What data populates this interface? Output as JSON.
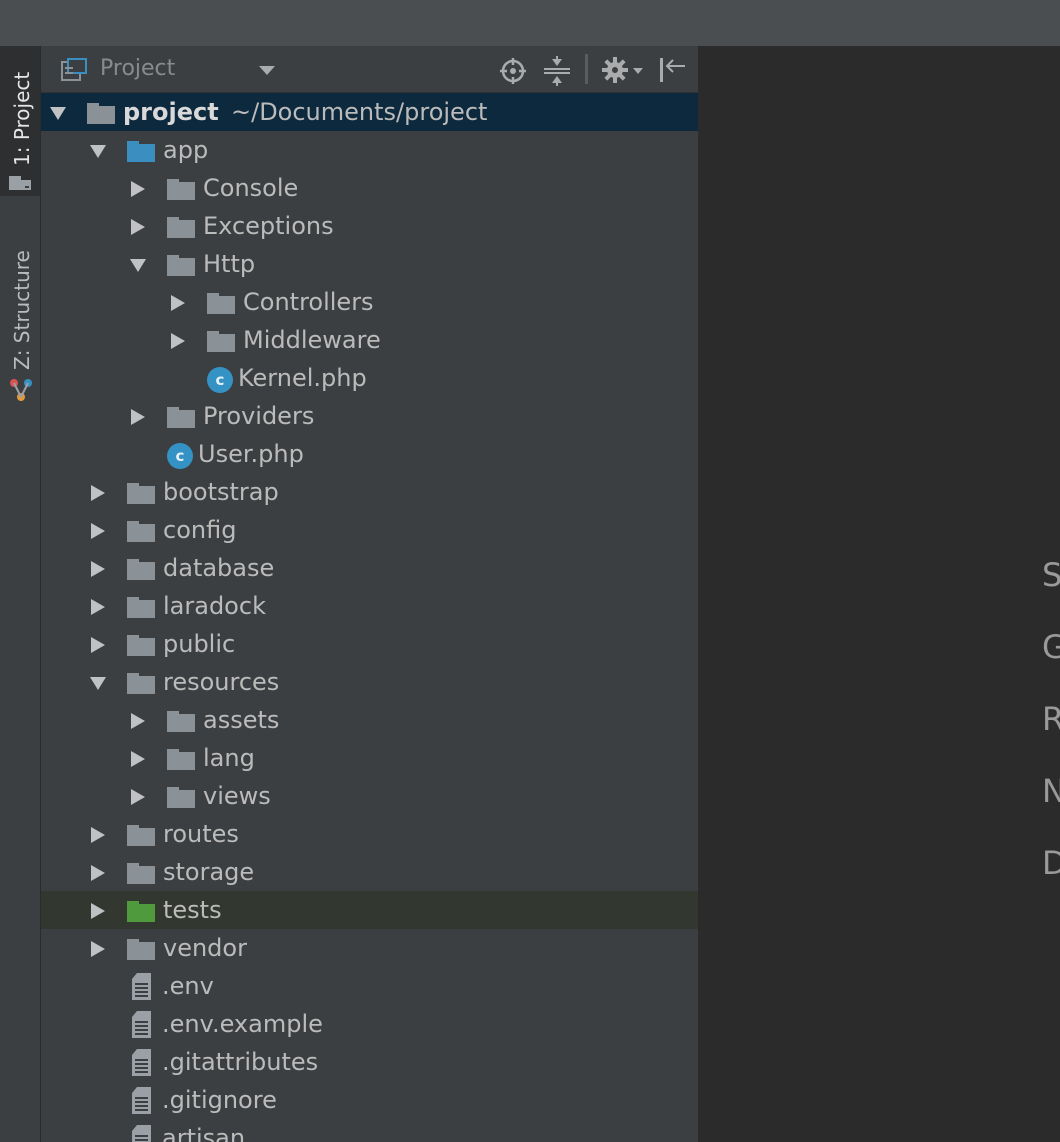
{
  "toolstrip": {
    "tabs": [
      {
        "label": "1: Project",
        "active": true,
        "icon": "folder-icon"
      },
      {
        "label": "Z: Structure",
        "active": false,
        "icon": "structure-icon"
      }
    ]
  },
  "panel": {
    "title": "Project",
    "toolbar_icons": [
      "scope-icon",
      "collapse-all-icon",
      "gear-icon",
      "hide-icon"
    ]
  },
  "tree": [
    {
      "label": "project",
      "path": "~/Documents/project",
      "depth": 0,
      "type": "folder",
      "expanded": true,
      "selected": true
    },
    {
      "label": "app",
      "depth": 1,
      "type": "folder-source",
      "expanded": true
    },
    {
      "label": "Console",
      "depth": 2,
      "type": "folder",
      "expanded": false
    },
    {
      "label": "Exceptions",
      "depth": 2,
      "type": "folder",
      "expanded": false
    },
    {
      "label": "Http",
      "depth": 2,
      "type": "folder",
      "expanded": true
    },
    {
      "label": "Controllers",
      "depth": 3,
      "type": "folder",
      "expanded": false
    },
    {
      "label": "Middleware",
      "depth": 3,
      "type": "folder",
      "expanded": false
    },
    {
      "label": "Kernel.php",
      "depth": 3,
      "type": "class"
    },
    {
      "label": "Providers",
      "depth": 2,
      "type": "folder",
      "expanded": false
    },
    {
      "label": "User.php",
      "depth": 2,
      "type": "class"
    },
    {
      "label": "bootstrap",
      "depth": 1,
      "type": "folder",
      "expanded": false
    },
    {
      "label": "config",
      "depth": 1,
      "type": "folder",
      "expanded": false
    },
    {
      "label": "database",
      "depth": 1,
      "type": "folder",
      "expanded": false
    },
    {
      "label": "laradock",
      "depth": 1,
      "type": "folder",
      "expanded": false
    },
    {
      "label": "public",
      "depth": 1,
      "type": "folder",
      "expanded": false
    },
    {
      "label": "resources",
      "depth": 1,
      "type": "folder",
      "expanded": true
    },
    {
      "label": "assets",
      "depth": 2,
      "type": "folder",
      "expanded": false
    },
    {
      "label": "lang",
      "depth": 2,
      "type": "folder",
      "expanded": false
    },
    {
      "label": "views",
      "depth": 2,
      "type": "folder",
      "expanded": false
    },
    {
      "label": "routes",
      "depth": 1,
      "type": "folder",
      "expanded": false
    },
    {
      "label": "storage",
      "depth": 1,
      "type": "folder",
      "expanded": false
    },
    {
      "label": "tests",
      "depth": 1,
      "type": "folder-test",
      "expanded": false,
      "highlight": true
    },
    {
      "label": "vendor",
      "depth": 1,
      "type": "folder",
      "expanded": false
    },
    {
      "label": ".env",
      "depth": 1,
      "type": "file"
    },
    {
      "label": ".env.example",
      "depth": 1,
      "type": "file"
    },
    {
      "label": ".gitattributes",
      "depth": 1,
      "type": "file"
    },
    {
      "label": ".gitignore",
      "depth": 1,
      "type": "file"
    },
    {
      "label": "artisan",
      "depth": 1,
      "type": "file"
    }
  ],
  "colors": {
    "folder": "#8a9197",
    "folder_source": "#3b8ec0",
    "folder_test": "#4e9a3c",
    "class_icon": "#3592c4",
    "selection": "#0d293e"
  },
  "editor_hints": [
    "S",
    "G",
    "R",
    "N",
    "D"
  ]
}
